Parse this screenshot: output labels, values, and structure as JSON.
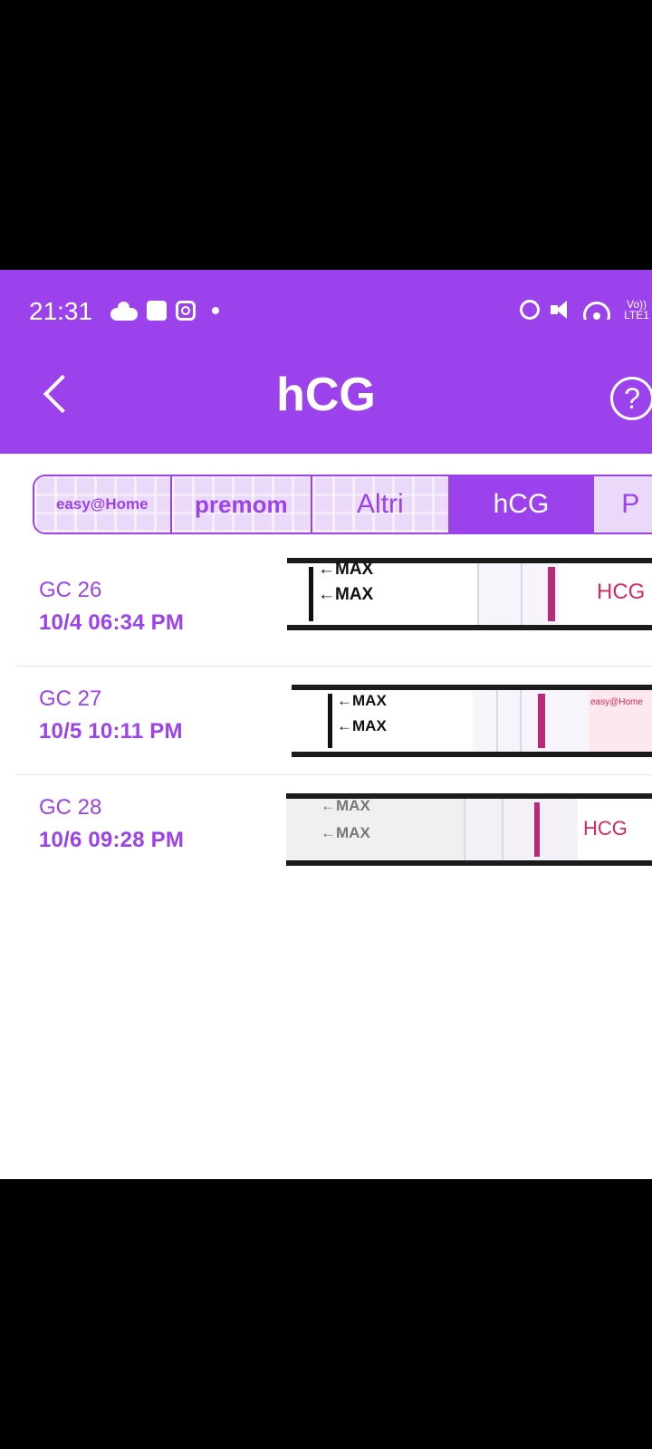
{
  "status_bar": {
    "time": "21:31",
    "network_label_top": "Vo))",
    "network_label_bottom": "LTE1"
  },
  "header": {
    "title": "hCG",
    "help_symbol": "?",
    "background_color": "#9b42ec"
  },
  "tabs": [
    {
      "label": "easy@Home",
      "selected": false
    },
    {
      "label": "premom",
      "selected": false
    },
    {
      "label": "Altri",
      "selected": false
    },
    {
      "label": "hCG",
      "selected": true
    },
    {
      "label": "P",
      "selected": false
    }
  ],
  "results": [
    {
      "name": "GC 26",
      "datetime": "10/4  06:34 PM",
      "strip": {
        "max_label": "←MAX",
        "brand_text": "HCG"
      }
    },
    {
      "name": "GC 27",
      "datetime": "10/5  10:11 PM",
      "strip": {
        "max_label": "←MAX",
        "brand_text": "easy@Home"
      }
    },
    {
      "name": "GC 28",
      "datetime": "10/6  09:28 PM",
      "strip": {
        "max_label": "←MAX",
        "brand_text": "HCG"
      }
    }
  ]
}
